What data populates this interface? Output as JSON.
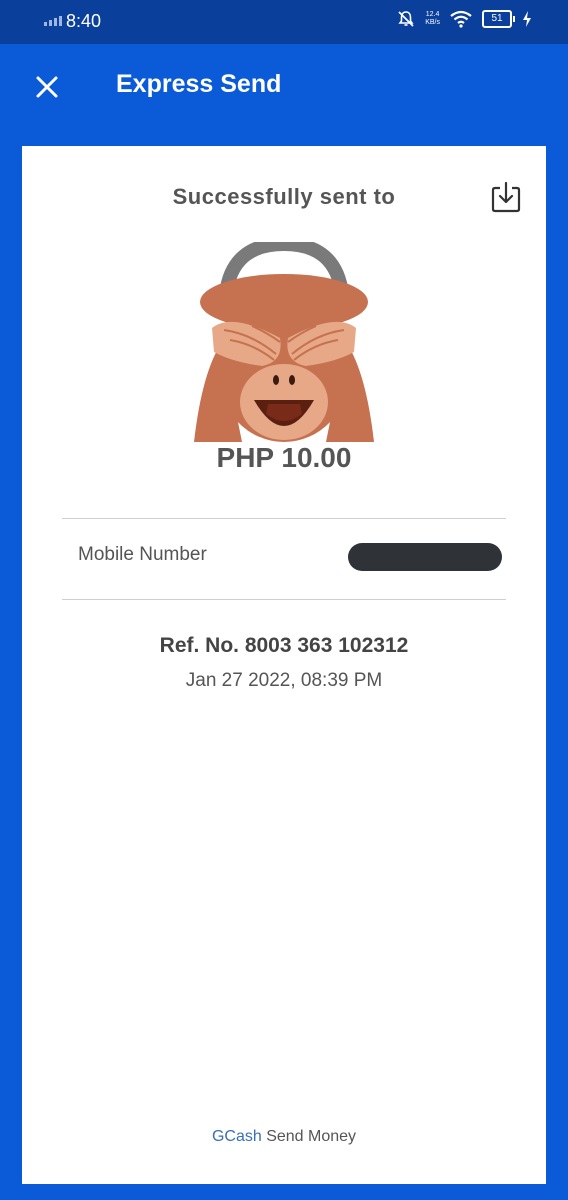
{
  "status_bar": {
    "time": "8:40",
    "net_speed_value": "12.4",
    "net_speed_unit": "KB/s",
    "battery": "51",
    "icons": [
      "signal-icon",
      "notification-off-icon",
      "wifi-icon",
      "battery-icon",
      "charging-icon"
    ]
  },
  "header": {
    "title": "Express Send",
    "close_icon": "close-icon"
  },
  "receipt": {
    "success_text": "Successfully sent to",
    "download_icon": "download-icon",
    "avatar": "see-no-evil-monkey",
    "amount": "PHP 10.00",
    "mobile_label": "Mobile Number",
    "mobile_value_redacted": true,
    "ref_no": "Ref. No. 8003 363 102312",
    "datetime": "Jan 27 2022, 08:39 PM",
    "footer_brand": "GCash",
    "footer_text": "Send Money"
  },
  "colors": {
    "primary": "#0b5bd8",
    "status_bar": "#0a3f9c",
    "text": "#555555"
  }
}
